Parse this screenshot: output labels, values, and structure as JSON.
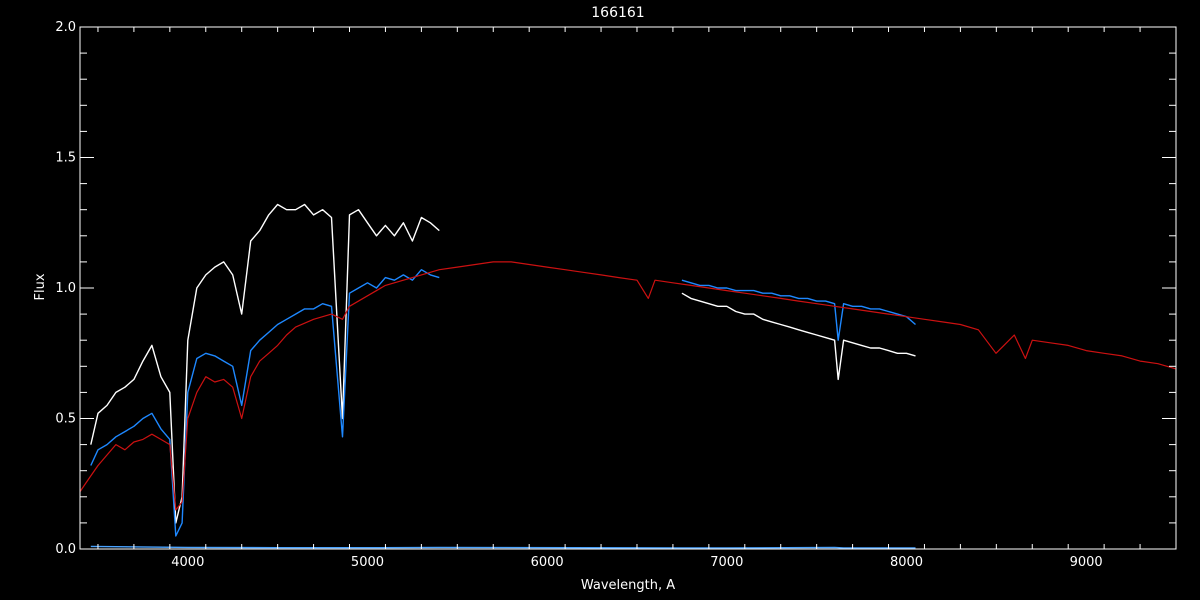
{
  "chart_data": {
    "type": "line",
    "title": "166161",
    "xlabel": "Wavelength, A",
    "ylabel": "Flux",
    "xlim": [
      3400,
      9500
    ],
    "ylim": [
      0,
      2.0
    ],
    "x_ticks": [
      4000,
      5000,
      6000,
      7000,
      8000,
      9000
    ],
    "y_ticks": [
      0.0,
      0.5,
      1.0,
      1.5,
      2.0
    ],
    "y_tick_labels": [
      "0.0",
      "0.5",
      "1.0",
      "1.5",
      "2.0"
    ],
    "grid": false,
    "colors": {
      "background": "#000000",
      "axes": "#ffffff",
      "observed_raw": "#ffffff",
      "observed_calibrated": "#1e88ff",
      "model": "#cc1111",
      "error": "#4aa3ff"
    },
    "series": [
      {
        "key": "observed_raw",
        "x": [
          3460,
          3500,
          3550,
          3600,
          3650,
          3700,
          3750,
          3800,
          3850,
          3900,
          3933,
          3968,
          4000,
          4050,
          4100,
          4150,
          4200,
          4250,
          4300,
          4350,
          4400,
          4450,
          4500,
          4550,
          4600,
          4650,
          4700,
          4750,
          4800,
          4861,
          4900,
          4950,
          5000,
          5050,
          5100,
          5150,
          5200,
          5250,
          5300,
          5350,
          5400
        ],
        "y": [
          0.4,
          0.52,
          0.55,
          0.6,
          0.62,
          0.65,
          0.72,
          0.78,
          0.66,
          0.6,
          0.1,
          0.2,
          0.8,
          1.0,
          1.05,
          1.08,
          1.1,
          1.05,
          0.9,
          1.18,
          1.22,
          1.28,
          1.32,
          1.3,
          1.3,
          1.32,
          1.28,
          1.3,
          1.27,
          0.5,
          1.28,
          1.3,
          1.25,
          1.2,
          1.24,
          1.2,
          1.25,
          1.18,
          1.27,
          1.25,
          1.22
        ]
      },
      {
        "key": "observed_calibrated",
        "x": [
          3460,
          3500,
          3550,
          3600,
          3650,
          3700,
          3750,
          3800,
          3850,
          3900,
          3933,
          3968,
          4000,
          4050,
          4100,
          4150,
          4200,
          4250,
          4300,
          4350,
          4400,
          4450,
          4500,
          4550,
          4600,
          4650,
          4700,
          4750,
          4800,
          4861,
          4900,
          4950,
          5000,
          5050,
          5100,
          5150,
          5200,
          5250,
          5300,
          5350,
          5400
        ],
        "y": [
          0.32,
          0.38,
          0.4,
          0.43,
          0.45,
          0.47,
          0.5,
          0.52,
          0.46,
          0.42,
          0.05,
          0.1,
          0.6,
          0.73,
          0.75,
          0.74,
          0.72,
          0.7,
          0.55,
          0.76,
          0.8,
          0.83,
          0.86,
          0.88,
          0.9,
          0.92,
          0.92,
          0.94,
          0.93,
          0.43,
          0.98,
          1.0,
          1.02,
          1.0,
          1.04,
          1.03,
          1.05,
          1.03,
          1.07,
          1.05,
          1.04
        ]
      },
      {
        "key": "observed_raw",
        "x": [
          6750,
          6800,
          6850,
          6900,
          6950,
          7000,
          7050,
          7100,
          7150,
          7200,
          7250,
          7300,
          7350,
          7400,
          7450,
          7500,
          7550,
          7600,
          7620,
          7650,
          7700,
          7750,
          7800,
          7850,
          7900,
          7950,
          8000,
          8050
        ],
        "y": [
          0.98,
          0.96,
          0.95,
          0.94,
          0.93,
          0.93,
          0.91,
          0.9,
          0.9,
          0.88,
          0.87,
          0.86,
          0.85,
          0.84,
          0.83,
          0.82,
          0.81,
          0.8,
          0.65,
          0.8,
          0.79,
          0.78,
          0.77,
          0.77,
          0.76,
          0.75,
          0.75,
          0.74
        ]
      },
      {
        "key": "observed_calibrated",
        "x": [
          6750,
          6800,
          6850,
          6900,
          6950,
          7000,
          7050,
          7100,
          7150,
          7200,
          7250,
          7300,
          7350,
          7400,
          7450,
          7500,
          7550,
          7600,
          7620,
          7650,
          7700,
          7750,
          7800,
          7850,
          7900,
          7950,
          8000,
          8050
        ],
        "y": [
          1.03,
          1.02,
          1.01,
          1.01,
          1.0,
          1.0,
          0.99,
          0.99,
          0.99,
          0.98,
          0.98,
          0.97,
          0.97,
          0.96,
          0.96,
          0.95,
          0.95,
          0.94,
          0.8,
          0.94,
          0.93,
          0.93,
          0.92,
          0.92,
          0.91,
          0.9,
          0.89,
          0.86
        ]
      },
      {
        "key": "model",
        "x": [
          3400,
          3450,
          3500,
          3550,
          3600,
          3650,
          3700,
          3750,
          3800,
          3850,
          3900,
          3933,
          3968,
          4000,
          4050,
          4100,
          4150,
          4200,
          4250,
          4300,
          4350,
          4400,
          4450,
          4500,
          4550,
          4600,
          4700,
          4800,
          4861,
          4900,
          5000,
          5100,
          5200,
          5300,
          5400,
          5500,
          5600,
          5700,
          5800,
          5900,
          6000,
          6100,
          6200,
          6300,
          6400,
          6500,
          6563,
          6600,
          6700,
          6800,
          6900,
          7000,
          7100,
          7200,
          7300,
          7400,
          7500,
          7600,
          7700,
          7800,
          7900,
          8000,
          8100,
          8200,
          8300,
          8400,
          8498,
          8542,
          8600,
          8662,
          8700,
          8800,
          8900,
          9000,
          9100,
          9200,
          9300,
          9400,
          9500
        ],
        "y": [
          0.22,
          0.27,
          0.32,
          0.36,
          0.4,
          0.38,
          0.41,
          0.42,
          0.44,
          0.42,
          0.4,
          0.15,
          0.18,
          0.5,
          0.6,
          0.66,
          0.64,
          0.65,
          0.62,
          0.5,
          0.66,
          0.72,
          0.75,
          0.78,
          0.82,
          0.85,
          0.88,
          0.9,
          0.88,
          0.93,
          0.97,
          1.01,
          1.03,
          1.05,
          1.07,
          1.08,
          1.09,
          1.1,
          1.1,
          1.09,
          1.08,
          1.07,
          1.06,
          1.05,
          1.04,
          1.03,
          0.96,
          1.03,
          1.02,
          1.01,
          1.0,
          0.99,
          0.98,
          0.97,
          0.96,
          0.95,
          0.94,
          0.93,
          0.92,
          0.91,
          0.9,
          0.89,
          0.88,
          0.87,
          0.86,
          0.84,
          0.75,
          0.78,
          0.82,
          0.73,
          0.8,
          0.79,
          0.78,
          0.76,
          0.75,
          0.74,
          0.72,
          0.71,
          0.69
        ]
      },
      {
        "key": "error",
        "x": [
          3460,
          4000,
          4500,
          5000,
          5400,
          6750,
          7000,
          7600,
          7650,
          8050
        ],
        "y": [
          0.01,
          0.006,
          0.005,
          0.005,
          0.006,
          0.004,
          0.004,
          0.006,
          0.004,
          0.004
        ]
      }
    ]
  }
}
